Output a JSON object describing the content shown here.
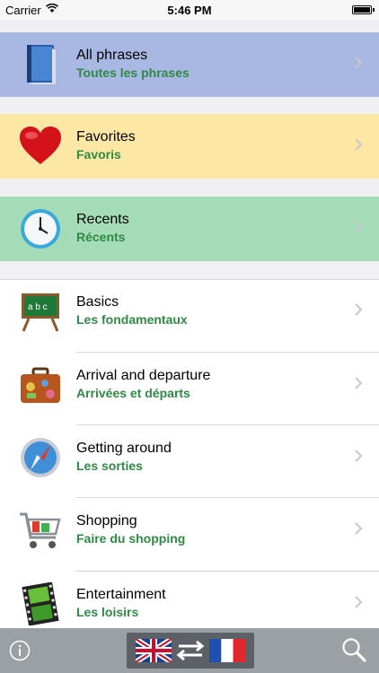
{
  "status": {
    "carrier": "Carrier",
    "time": "5:46 PM"
  },
  "special": [
    {
      "en": "All phrases",
      "fr": "Toutes les phrases",
      "bg": "#a9b8e2",
      "icon": "book-icon"
    },
    {
      "en": "Favorites",
      "fr": "Favoris",
      "bg": "#fde7a4",
      "icon": "heart-icon"
    },
    {
      "en": "Recents",
      "fr": "Récents",
      "bg": "#a5dcb8",
      "icon": "clock-icon"
    }
  ],
  "categories": [
    {
      "en": "Basics",
      "fr": "Les fondamentaux",
      "icon": "chalkboard-icon"
    },
    {
      "en": "Arrival and departure",
      "fr": "Arrivées et départs",
      "icon": "suitcase-icon"
    },
    {
      "en": "Getting around",
      "fr": "Les sorties",
      "icon": "compass-icon"
    },
    {
      "en": "Shopping",
      "fr": "Faire du shopping",
      "icon": "shopping-cart-icon"
    },
    {
      "en": "Entertainment",
      "fr": "Les loisirs",
      "icon": "film-strip-icon"
    }
  ],
  "toolbar": {
    "info_icon": "info-icon",
    "language_icon": "uk-fr-flags-icon",
    "search_icon": "search-icon"
  }
}
